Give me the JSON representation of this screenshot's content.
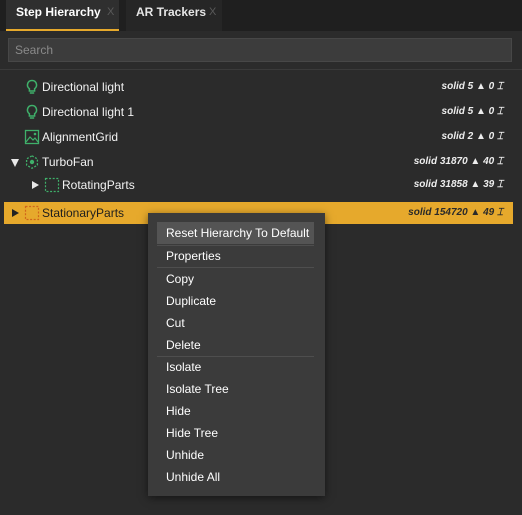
{
  "tabs": [
    {
      "label": "Step Hierarchy",
      "close": "X",
      "active": true
    },
    {
      "label": "AR Trackers",
      "close": "X",
      "active": false
    }
  ],
  "search": {
    "placeholder": "Search"
  },
  "tree": [
    {
      "label": "Directional light",
      "icon": "light-bulb-icon",
      "stats": "solid 5 ▲ 0 ⌶"
    },
    {
      "label": "Directional light 1",
      "icon": "light-bulb-icon",
      "stats": "solid 5 ▲ 0 ⌶"
    },
    {
      "label": "AlignmentGrid",
      "icon": "grid-image-icon",
      "stats": "solid 2 ▲ 0 ⌶"
    },
    {
      "label": "TurboFan",
      "icon": "assembly-icon",
      "expanded": true,
      "stats": "solid 31870 ▲ 40 ⌶"
    },
    {
      "label": "RotatingParts",
      "icon": "part-group-icon",
      "expanded": false,
      "stats": "solid 31858 ▲ 39 ⌶"
    },
    {
      "label": "StationaryParts",
      "icon": "part-group-icon",
      "expanded": false,
      "selected": true,
      "stats": "solid 154720 ▲ 49 ⌶"
    }
  ],
  "context_menu": {
    "items": [
      {
        "label": "Reset Hierarchy To Default",
        "hovered": true
      },
      {
        "label": "Properties"
      },
      {
        "label": "Copy"
      },
      {
        "label": "Duplicate"
      },
      {
        "label": "Cut"
      },
      {
        "label": "Delete"
      },
      {
        "label": "Isolate"
      },
      {
        "label": "Isolate Tree"
      },
      {
        "label": "Hide"
      },
      {
        "label": "Hide Tree"
      },
      {
        "label": "Unhide"
      },
      {
        "label": "Unhide All"
      }
    ]
  },
  "colors": {
    "accent": "#e6a92c",
    "icon_green": "#3fb06a",
    "panel_bg": "#2b2b2b",
    "menu_bg": "#3b3b3b"
  }
}
